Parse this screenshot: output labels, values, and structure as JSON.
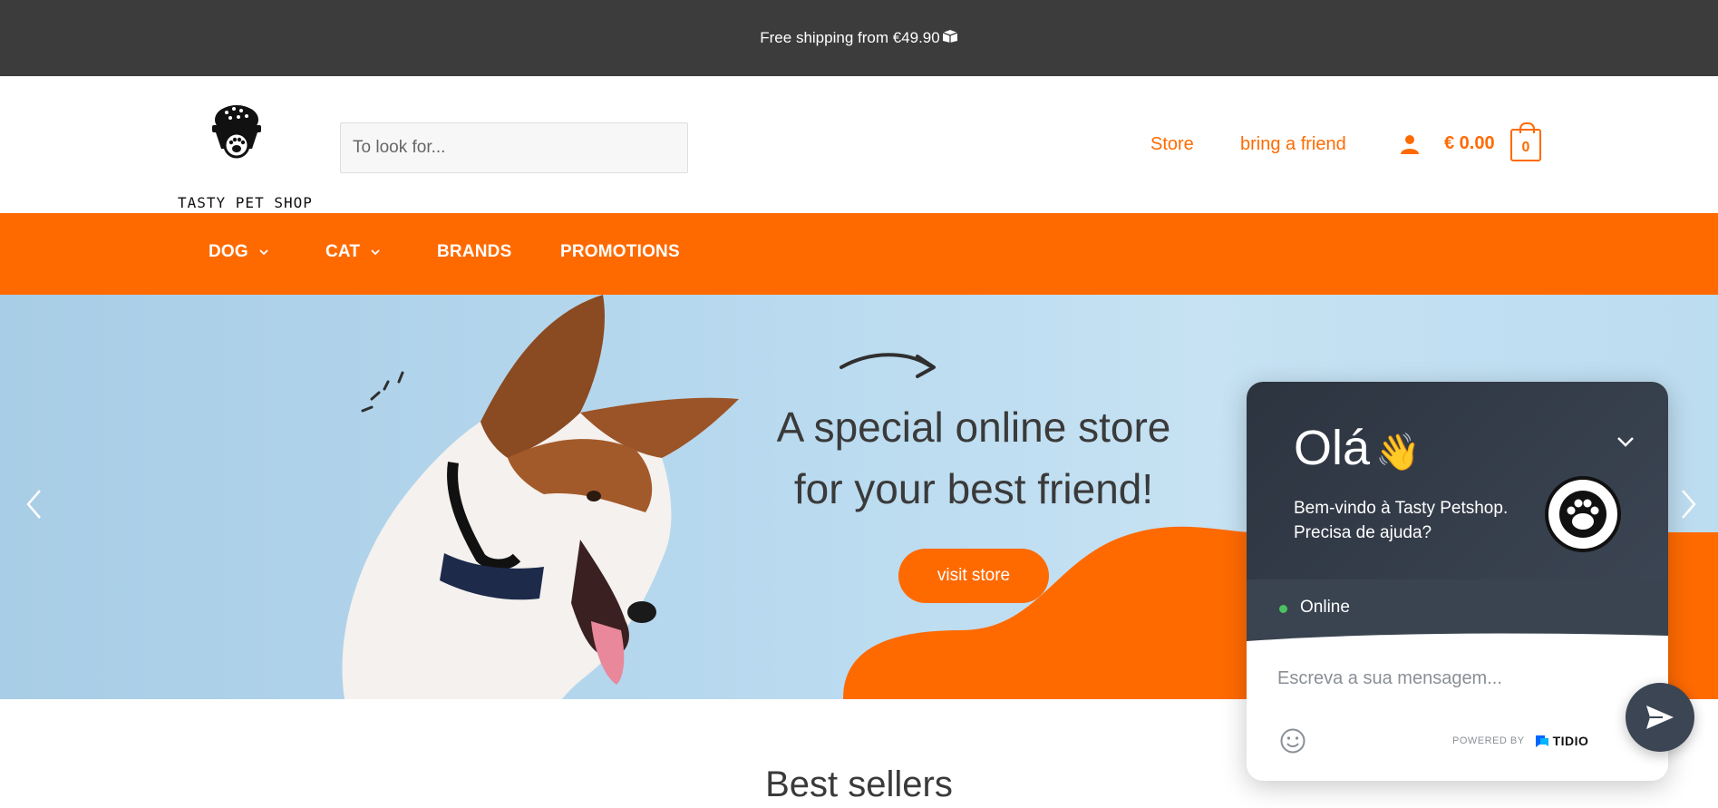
{
  "announcement": {
    "text": "Free shipping from €49.90",
    "icon": "box-icon"
  },
  "header": {
    "logo_text": "TASTY PET SHOP",
    "search_placeholder": "To look for...",
    "links": {
      "store": "Store",
      "friend": "bring a friend"
    },
    "cart_total": "€ 0.00",
    "cart_count": "0"
  },
  "nav": {
    "items": [
      {
        "label": "DOG",
        "has_dropdown": true
      },
      {
        "label": "CAT",
        "has_dropdown": true
      },
      {
        "label": "BRANDS",
        "has_dropdown": false
      },
      {
        "label": "PROMOTIONS",
        "has_dropdown": false
      }
    ]
  },
  "hero": {
    "title_line1": "A special online store",
    "title_line2": "for your best friend!",
    "button": "visit store"
  },
  "section_title": "Best sellers",
  "chat": {
    "greeting": "Olá",
    "greeting_emoji": "👋",
    "message_line1": "Bem-vindo à Tasty Petshop.",
    "message_line2": "Precisa de ajuda?",
    "status": "Online",
    "input_placeholder": "Escreva a sua mensagem...",
    "powered_by": "POWERED BY",
    "brand": "TIDIO"
  },
  "colors": {
    "accent": "#ff6a00",
    "topbar": "#3c3c3c",
    "chat_dark": "#2c3440",
    "online": "#4bc25f"
  }
}
